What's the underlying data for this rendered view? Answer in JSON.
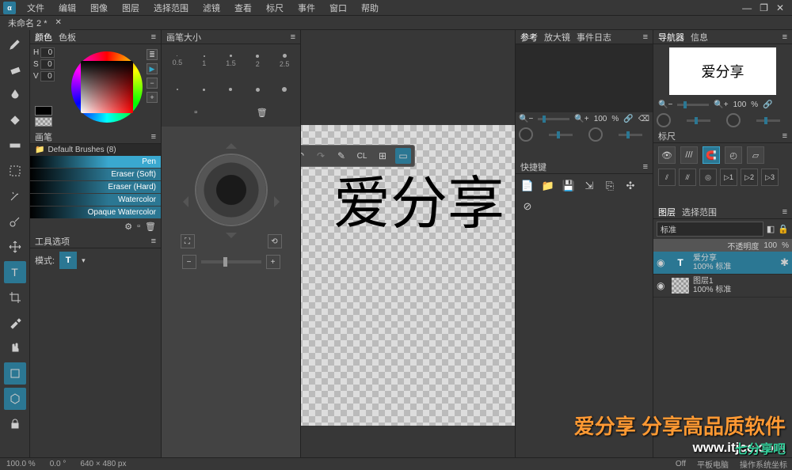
{
  "menu": [
    "文件",
    "编辑",
    "图像",
    "图层",
    "选择范围",
    "滤镜",
    "查看",
    "标尺",
    "事件",
    "窗口",
    "帮助"
  ],
  "doc_tab": {
    "title": "未命名 2 *"
  },
  "color": {
    "tab1": "颜色",
    "tab2": "色板",
    "h_label": "H",
    "s_label": "S",
    "v_label": "V",
    "h": "0",
    "s": "0",
    "v": "0"
  },
  "brush": {
    "title": "画笔",
    "group": "Default Brushes (8)",
    "items": [
      "Pen",
      "Eraser (Soft)",
      "Eraser (Hard)",
      "Watercolor",
      "Opaque Watercolor"
    ]
  },
  "tool_options": {
    "title": "工具选项",
    "mode_label": "模式:"
  },
  "brush_size": {
    "title": "画笔大小",
    "sizes": [
      "0.5",
      "1",
      "1.5",
      "2",
      "2.5"
    ]
  },
  "reference": {
    "tab1": "参考",
    "tab2": "放大镜",
    "tab3": "事件日志",
    "zoom": "100",
    "unit": "%"
  },
  "shortcuts": {
    "title": "快捷键"
  },
  "navigator": {
    "tab1": "导航器",
    "tab2": "信息",
    "preview_text": "爱分享",
    "zoom": "100",
    "unit": "%"
  },
  "ruler": {
    "title": "标尺"
  },
  "layers": {
    "tab1": "图层",
    "tab2": "选择范围",
    "mode": "标准",
    "opacity_label": "不透明度",
    "opacity": "100",
    "unit": "%",
    "items": [
      {
        "name": "爱分享",
        "sub": "100% 标准",
        "type": "T"
      },
      {
        "name": "图层1",
        "sub": "100% 标准",
        "type": "checker"
      }
    ]
  },
  "canvas_text": "爱分享",
  "status": {
    "zoom": "100.0 %",
    "angle": "0.0 °",
    "dims": "640 × 480 px",
    "off": "Off",
    "tablet": "平板电脑",
    "sys": "操作系统坐标"
  },
  "watermark": {
    "line1": "爱分享 分享高品质软件",
    "line2": "www.itjcc.com",
    "logo": "七分享吧"
  }
}
